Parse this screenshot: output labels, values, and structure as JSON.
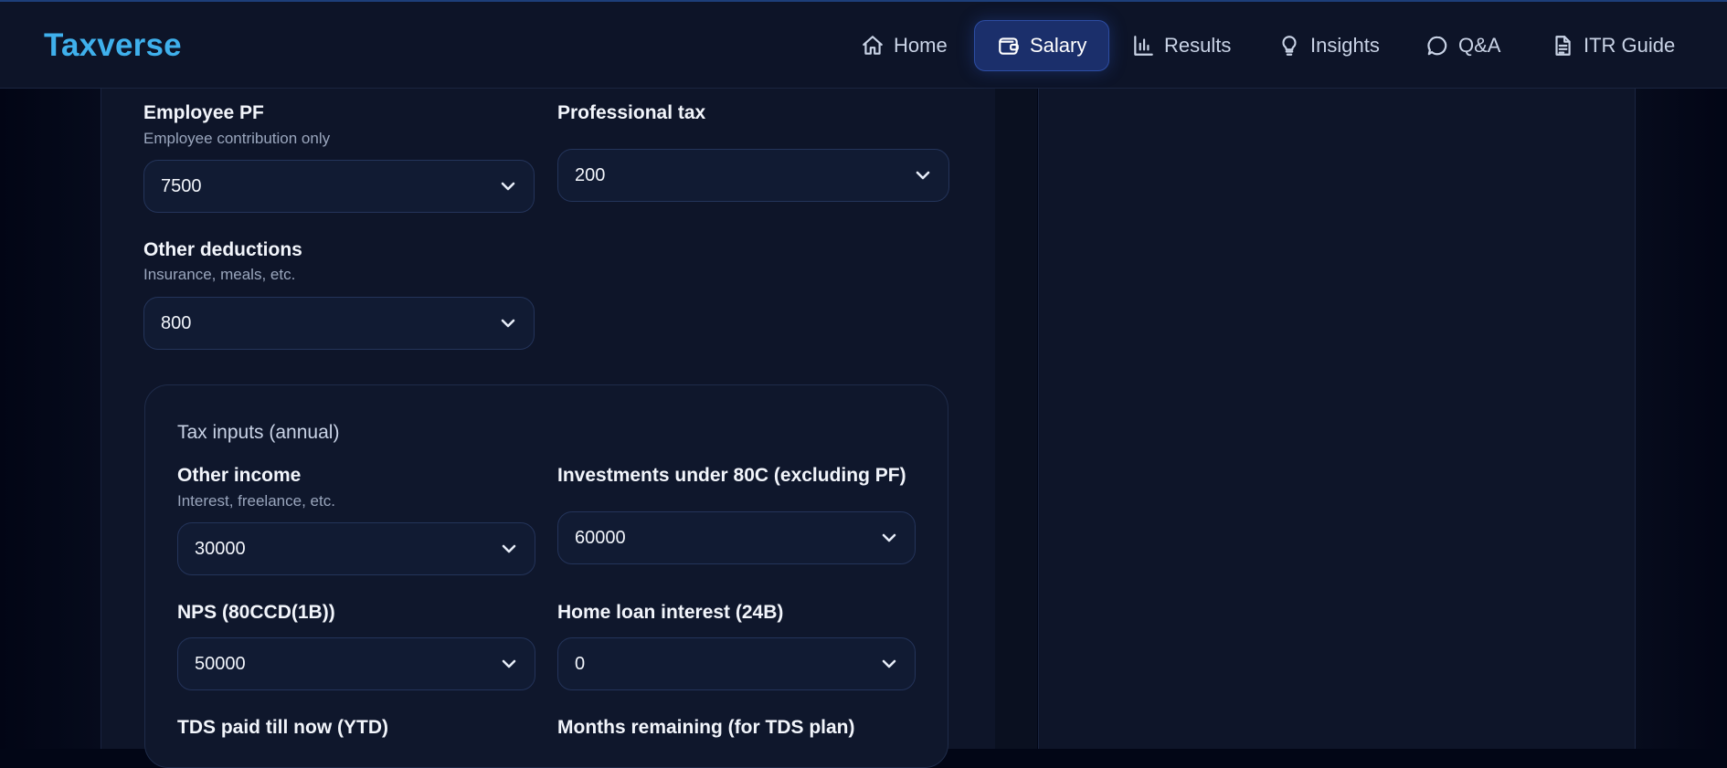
{
  "app": {
    "brand": "Taxverse"
  },
  "nav": {
    "items": [
      {
        "label": "Home",
        "icon": "home-icon"
      },
      {
        "label": "Salary",
        "icon": "wallet-icon",
        "active": true
      },
      {
        "label": "Results",
        "icon": "bar-chart-icon"
      },
      {
        "label": "Insights",
        "icon": "lightbulb-icon"
      },
      {
        "label": "Q&A",
        "icon": "chat-bubble-icon"
      },
      {
        "label": "ITR Guide",
        "icon": "document-icon"
      }
    ]
  },
  "deductions": {
    "employee_pf": {
      "label": "Employee PF",
      "help": "Employee contribution only",
      "value": "7500"
    },
    "professional_tax": {
      "label": "Professional tax",
      "value": "200"
    },
    "other_deductions": {
      "label": "Other deductions",
      "help": "Insurance, meals, etc.",
      "value": "800"
    }
  },
  "tax_inputs": {
    "title": "Tax inputs (annual)",
    "other_income": {
      "label": "Other income",
      "help": "Interest, freelance, etc.",
      "value": "30000"
    },
    "investments_80c": {
      "label": "Investments under 80C (excluding PF)",
      "value": "60000"
    },
    "nps": {
      "label": "NPS (80CCD(1B))",
      "value": "50000"
    },
    "home_loan_interest": {
      "label": "Home loan interest (24B)",
      "value": "0"
    },
    "tds_paid": {
      "label": "TDS paid till now (YTD)"
    },
    "months_remaining": {
      "label": "Months remaining (for TDS plan)"
    }
  },
  "colors": {
    "brand": "#3fb0ec",
    "active_nav_bg": "#1b2f6b",
    "background": "#020616",
    "panel": "#0e1529"
  }
}
